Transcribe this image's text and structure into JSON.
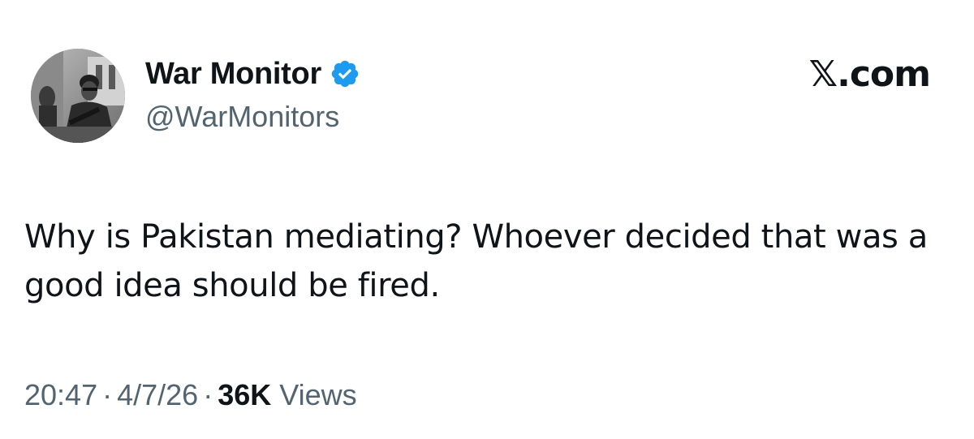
{
  "author": {
    "display_name": "War Monitor",
    "handle": "@WarMonitors",
    "verified_icon": "verified-badge-icon",
    "badge_color": "#1d9bf0"
  },
  "brand": {
    "label": "𝕏.com"
  },
  "tweet": {
    "text": "Why is Pakistan mediating? Whoever decided that was a good idea should be fired."
  },
  "meta": {
    "time": "20:47",
    "separator": "·",
    "date": "4/7/26",
    "views_count": "36K",
    "views_label": "Views"
  },
  "colors": {
    "primary_text": "#0f1419",
    "secondary_text": "#536471"
  }
}
